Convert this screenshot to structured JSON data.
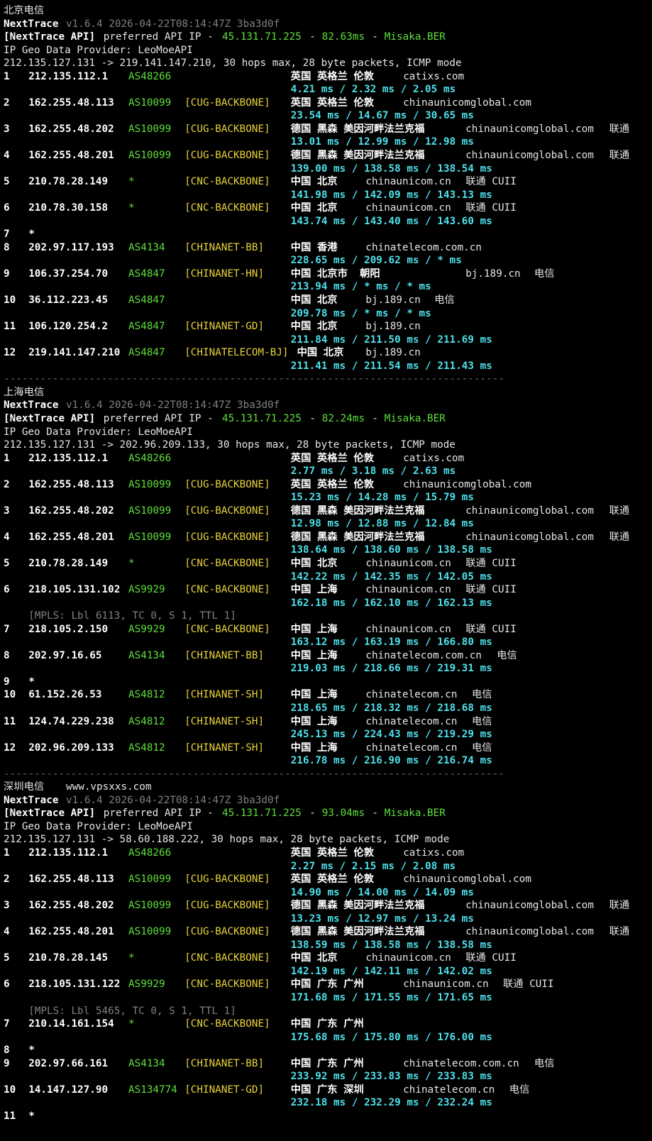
{
  "sections": [
    {
      "label": "北京电信",
      "extra": "",
      "tool": "NextTrace",
      "version": "v1.6.4 2026-04-22T08:14:47Z 3ba3d0f",
      "api_tag": "[NextTrace API]",
      "api_pref": "preferred API IP -",
      "api_ip": "45.131.71.225",
      "api_dash": "-",
      "api_ms": "82.63ms",
      "api_dash2": "-",
      "api_node": "Misaka.BER",
      "geo": "IP Geo Data Provider: LeoMoeAPI",
      "route": "212.135.127.131 -> 219.141.147.210, 30 hops max, 28 byte packets, ICMP mode",
      "hops": [
        {
          "n": "1",
          "ip": "212.135.112.1",
          "as": "AS48266",
          "tag": "",
          "geo": "英国 英格兰 伦敦",
          "host": "catixs.com",
          "isp": "",
          "rtt": "4.21 ms / 2.32 ms / 2.05 ms",
          "mpls": ""
        },
        {
          "n": "2",
          "ip": "162.255.48.113",
          "as": "AS10099",
          "tag": "[CUG-BACKBONE]",
          "geo": "英国 英格兰 伦敦",
          "host": "chinaunicomglobal.com",
          "isp": "",
          "rtt": "23.54 ms / 14.67 ms / 30.65 ms",
          "mpls": ""
        },
        {
          "n": "3",
          "ip": "162.255.48.202",
          "as": "AS10099",
          "tag": "[CUG-BACKBONE]",
          "geo": "德国 黑森 美因河畔法兰克福",
          "host": "chinaunicomglobal.com",
          "isp": "联通",
          "rtt": "13.01 ms / 12.99 ms / 12.98 ms",
          "mpls": ""
        },
        {
          "n": "4",
          "ip": "162.255.48.201",
          "as": "AS10099",
          "tag": "[CUG-BACKBONE]",
          "geo": "德国 黑森 美因河畔法兰克福",
          "host": "chinaunicomglobal.com",
          "isp": "联通",
          "rtt": "139.00 ms / 138.58 ms / 138.54 ms",
          "mpls": ""
        },
        {
          "n": "5",
          "ip": "210.78.28.149",
          "as": "*",
          "tag": "[CNC-BACKBONE]",
          "geo": "中国 北京",
          "host": "chinaunicom.cn",
          "isp": "联通 CUII",
          "rtt": "141.98 ms / 142.09 ms / 143.13 ms",
          "mpls": ""
        },
        {
          "n": "6",
          "ip": "210.78.30.158",
          "as": "*",
          "tag": "[CNC-BACKBONE]",
          "geo": "中国 北京",
          "host": "chinaunicom.cn",
          "isp": "联通 CUII",
          "rtt": "143.74 ms / 143.40 ms / 143.60 ms",
          "mpls": ""
        },
        {
          "n": "7",
          "ip": "*",
          "as": "",
          "tag": "",
          "geo": "",
          "host": "",
          "isp": "",
          "rtt": "",
          "mpls": ""
        },
        {
          "n": "8",
          "ip": "202.97.117.193",
          "as": "AS4134",
          "tag": "[CHINANET-BB]",
          "geo": "中国 香港",
          "host": "chinatelecom.com.cn",
          "isp": "",
          "rtt": "228.65 ms / 209.62 ms / * ms",
          "mpls": ""
        },
        {
          "n": "9",
          "ip": "106.37.254.70",
          "as": "AS4847",
          "tag": "[CHINANET-HN]",
          "geo": "中国 北京市  朝阳",
          "host": "bj.189.cn",
          "isp": "电信",
          "rtt": "213.94 ms / * ms / * ms",
          "mpls": ""
        },
        {
          "n": "10",
          "ip": "36.112.223.45",
          "as": "AS4847",
          "tag": "",
          "geo": "中国 北京",
          "host": "bj.189.cn",
          "isp": "电信",
          "rtt": "209.78 ms / * ms / * ms",
          "mpls": ""
        },
        {
          "n": "11",
          "ip": "106.120.254.2",
          "as": "AS4847",
          "tag": "[CHINANET-GD]",
          "geo": "中国 北京",
          "host": "bj.189.cn",
          "isp": "",
          "rtt": "211.84 ms / 211.50 ms / 211.69 ms",
          "mpls": ""
        },
        {
          "n": "12",
          "ip": "219.141.147.210",
          "as": "AS4847",
          "tag": "[CHINATELECOM-BJ]",
          "geo": "中国 北京",
          "host": "bj.189.cn",
          "isp": "",
          "rtt": "211.41 ms / 211.54 ms / 211.43 ms",
          "mpls": ""
        }
      ],
      "divider": "----------------------------------------------------------------------------------"
    },
    {
      "label": "上海电信",
      "extra": "",
      "tool": "NextTrace",
      "version": "v1.6.4 2026-04-22T08:14:47Z 3ba3d0f",
      "api_tag": "[NextTrace API]",
      "api_pref": "preferred API IP -",
      "api_ip": "45.131.71.225",
      "api_dash": "-",
      "api_ms": "82.24ms",
      "api_dash2": "-",
      "api_node": "Misaka.BER",
      "geo": "IP Geo Data Provider: LeoMoeAPI",
      "route": "212.135.127.131 -> 202.96.209.133, 30 hops max, 28 byte packets, ICMP mode",
      "hops": [
        {
          "n": "1",
          "ip": "212.135.112.1",
          "as": "AS48266",
          "tag": "",
          "geo": "英国 英格兰 伦敦",
          "host": "catixs.com",
          "isp": "",
          "rtt": "2.77 ms / 3.18 ms / 2.63 ms",
          "mpls": ""
        },
        {
          "n": "2",
          "ip": "162.255.48.113",
          "as": "AS10099",
          "tag": "[CUG-BACKBONE]",
          "geo": "英国 英格兰 伦敦",
          "host": "chinaunicomglobal.com",
          "isp": "",
          "rtt": "15.23 ms / 14.28 ms / 15.79 ms",
          "mpls": ""
        },
        {
          "n": "3",
          "ip": "162.255.48.202",
          "as": "AS10099",
          "tag": "[CUG-BACKBONE]",
          "geo": "德国 黑森 美因河畔法兰克福",
          "host": "chinaunicomglobal.com",
          "isp": "联通",
          "rtt": "12.98 ms / 12.88 ms / 12.84 ms",
          "mpls": ""
        },
        {
          "n": "4",
          "ip": "162.255.48.201",
          "as": "AS10099",
          "tag": "[CUG-BACKBONE]",
          "geo": "德国 黑森 美因河畔法兰克福",
          "host": "chinaunicomglobal.com",
          "isp": "联通",
          "rtt": "138.64 ms / 138.60 ms / 138.58 ms",
          "mpls": ""
        },
        {
          "n": "5",
          "ip": "210.78.28.149",
          "as": "*",
          "tag": "[CNC-BACKBONE]",
          "geo": "中国 北京",
          "host": "chinaunicom.cn",
          "isp": "联通 CUII",
          "rtt": "142.22 ms / 142.35 ms / 142.05 ms",
          "mpls": ""
        },
        {
          "n": "6",
          "ip": "218.105.131.102",
          "as": "AS9929",
          "tag": "[CNC-BACKBONE]",
          "geo": "中国 上海",
          "host": "chinaunicom.cn",
          "isp": "联通 CUII",
          "rtt": "162.18 ms / 162.10 ms / 162.13 ms",
          "mpls": "[MPLS: Lbl 6113, TC 0, S 1, TTL 1]"
        },
        {
          "n": "7",
          "ip": "218.105.2.150",
          "as": "AS9929",
          "tag": "[CNC-BACKBONE]",
          "geo": "中国 上海",
          "host": "chinaunicom.cn",
          "isp": "联通 CUII",
          "rtt": "163.12 ms / 163.19 ms / 166.80 ms",
          "mpls": ""
        },
        {
          "n": "8",
          "ip": "202.97.16.65",
          "as": "AS4134",
          "tag": "[CHINANET-BB]",
          "geo": "中国 上海",
          "host": "chinatelecom.com.cn",
          "isp": "电信",
          "rtt": "219.03 ms / 218.66 ms / 219.31 ms",
          "mpls": ""
        },
        {
          "n": "9",
          "ip": "*",
          "as": "",
          "tag": "",
          "geo": "",
          "host": "",
          "isp": "",
          "rtt": "",
          "mpls": ""
        },
        {
          "n": "10",
          "ip": "61.152.26.53",
          "as": "AS4812",
          "tag": "[CHINANET-SH]",
          "geo": "中国 上海",
          "host": "chinatelecom.cn",
          "isp": "电信",
          "rtt": "218.65 ms / 218.32 ms / 218.68 ms",
          "mpls": ""
        },
        {
          "n": "11",
          "ip": "124.74.229.238",
          "as": "AS4812",
          "tag": "[CHINANET-SH]",
          "geo": "中国 上海",
          "host": "chinatelecom.cn",
          "isp": "电信",
          "rtt": "245.13 ms / 224.43 ms / 219.29 ms",
          "mpls": ""
        },
        {
          "n": "12",
          "ip": "202.96.209.133",
          "as": "AS4812",
          "tag": "[CHINANET-SH]",
          "geo": "中国 上海",
          "host": "chinatelecom.cn",
          "isp": "电信",
          "rtt": "216.78 ms / 216.90 ms / 216.74 ms",
          "mpls": ""
        }
      ],
      "divider": "----------------------------------------------------------------------------------"
    },
    {
      "label": "深圳电信",
      "extra": "www.vpsxxs.com",
      "tool": "NextTrace",
      "version": "v1.6.4 2026-04-22T08:14:47Z 3ba3d0f",
      "api_tag": "[NextTrace API]",
      "api_pref": "preferred API IP -",
      "api_ip": "45.131.71.225",
      "api_dash": "-",
      "api_ms": "93.04ms",
      "api_dash2": "-",
      "api_node": "Misaka.BER",
      "geo": "IP Geo Data Provider: LeoMoeAPI",
      "route": "212.135.127.131 -> 58.60.188.222, 30 hops max, 28 byte packets, ICMP mode",
      "hops": [
        {
          "n": "1",
          "ip": "212.135.112.1",
          "as": "AS48266",
          "tag": "",
          "geo": "英国 英格兰 伦敦",
          "host": "catixs.com",
          "isp": "",
          "rtt": "2.27 ms / 2.15 ms / 2.08 ms",
          "mpls": ""
        },
        {
          "n": "2",
          "ip": "162.255.48.113",
          "as": "AS10099",
          "tag": "[CUG-BACKBONE]",
          "geo": "英国 英格兰 伦敦",
          "host": "chinaunicomglobal.com",
          "isp": "",
          "rtt": "14.90 ms / 14.00 ms / 14.09 ms",
          "mpls": ""
        },
        {
          "n": "3",
          "ip": "162.255.48.202",
          "as": "AS10099",
          "tag": "[CUG-BACKBONE]",
          "geo": "德国 黑森 美因河畔法兰克福",
          "host": "chinaunicomglobal.com",
          "isp": "联通",
          "rtt": "13.23 ms / 12.97 ms / 13.24 ms",
          "mpls": ""
        },
        {
          "n": "4",
          "ip": "162.255.48.201",
          "as": "AS10099",
          "tag": "[CUG-BACKBONE]",
          "geo": "德国 黑森 美因河畔法兰克福",
          "host": "chinaunicomglobal.com",
          "isp": "联通",
          "rtt": "138.59 ms / 138.58 ms / 138.58 ms",
          "mpls": ""
        },
        {
          "n": "5",
          "ip": "210.78.28.145",
          "as": "*",
          "tag": "[CNC-BACKBONE]",
          "geo": "中国 北京",
          "host": "chinaunicom.cn",
          "isp": "联通 CUII",
          "rtt": "142.19 ms / 142.11 ms / 142.02 ms",
          "mpls": ""
        },
        {
          "n": "6",
          "ip": "218.105.131.122",
          "as": "AS9929",
          "tag": "[CNC-BACKBONE]",
          "geo": "中国 广东 广州",
          "host": "chinaunicom.cn",
          "isp": "联通 CUII",
          "rtt": "171.68 ms / 171.55 ms / 171.65 ms",
          "mpls": "[MPLS: Lbl 5465, TC 0, S 1, TTL 1]"
        },
        {
          "n": "7",
          "ip": "210.14.161.154",
          "as": "*",
          "tag": "[CNC-BACKBONE]",
          "geo": "中国 广东 广州",
          "host": "",
          "isp": "",
          "rtt": "175.68 ms / 175.80 ms / 176.00 ms",
          "mpls": ""
        },
        {
          "n": "8",
          "ip": "*",
          "as": "",
          "tag": "",
          "geo": "",
          "host": "",
          "isp": "",
          "rtt": "",
          "mpls": ""
        },
        {
          "n": "9",
          "ip": "202.97.66.161",
          "as": "AS4134",
          "tag": "[CHINANET-BB]",
          "geo": "中国 广东 广州",
          "host": "chinatelecom.com.cn",
          "isp": "电信",
          "rtt": "233.92 ms / 233.83 ms / 233.83 ms",
          "mpls": ""
        },
        {
          "n": "10",
          "ip": "14.147.127.90",
          "as": "AS134774",
          "tag": "[CHINANET-GD]",
          "geo": "中国 广东 深圳",
          "host": "chinatelecom.cn",
          "isp": "电信",
          "rtt": "232.18 ms / 232.29 ms / 232.24 ms",
          "mpls": ""
        },
        {
          "n": "11",
          "ip": "*",
          "as": "",
          "tag": "",
          "geo": "",
          "host": "",
          "isp": "",
          "rtt": "",
          "mpls": ""
        }
      ],
      "divider": ""
    }
  ],
  "colors": {
    "background": "#000000",
    "text": "#e6e6e6",
    "green": "#5fdf3c",
    "yellow": "#e8d23a",
    "cyan": "#4fe0ea",
    "gray": "#808080"
  }
}
